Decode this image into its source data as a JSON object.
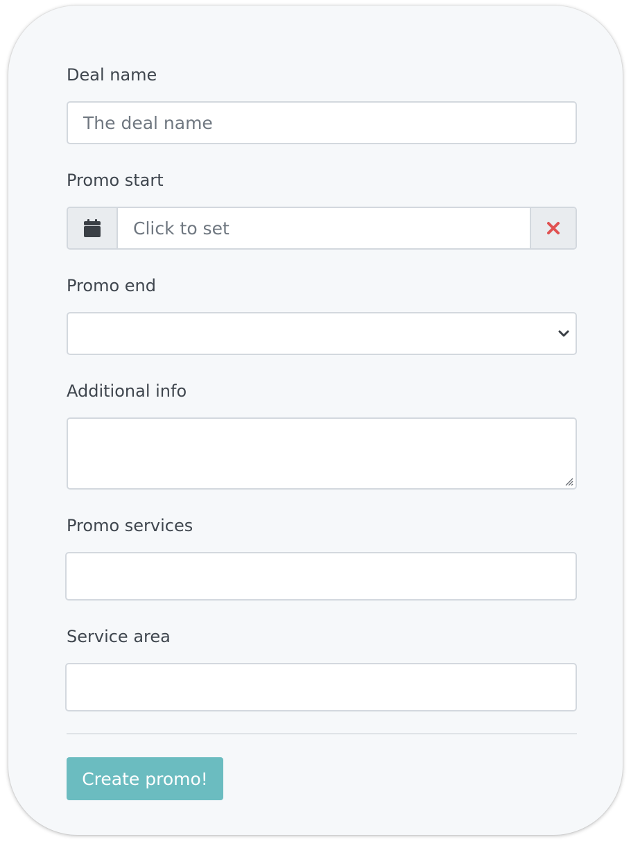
{
  "form": {
    "deal_name": {
      "label": "Deal name",
      "placeholder": "The deal name",
      "value": ""
    },
    "promo_start": {
      "label": "Promo start",
      "placeholder": "Click to set",
      "value": "",
      "left_icon": "calendar-icon",
      "clear_icon": "close-icon"
    },
    "promo_end": {
      "label": "Promo end",
      "selected": "",
      "indicator_icon": "chevron-down-icon"
    },
    "additional_info": {
      "label": "Additional info",
      "value": ""
    },
    "promo_services": {
      "label": "Promo services",
      "value": ""
    },
    "service_area": {
      "label": "Service area",
      "value": ""
    },
    "submit_label": "Create promo!"
  },
  "colors": {
    "card_background": "#f6f8fa",
    "button": "#6bbcc0",
    "clear_icon": "#e05151",
    "addon_background": "#e9ecef"
  }
}
